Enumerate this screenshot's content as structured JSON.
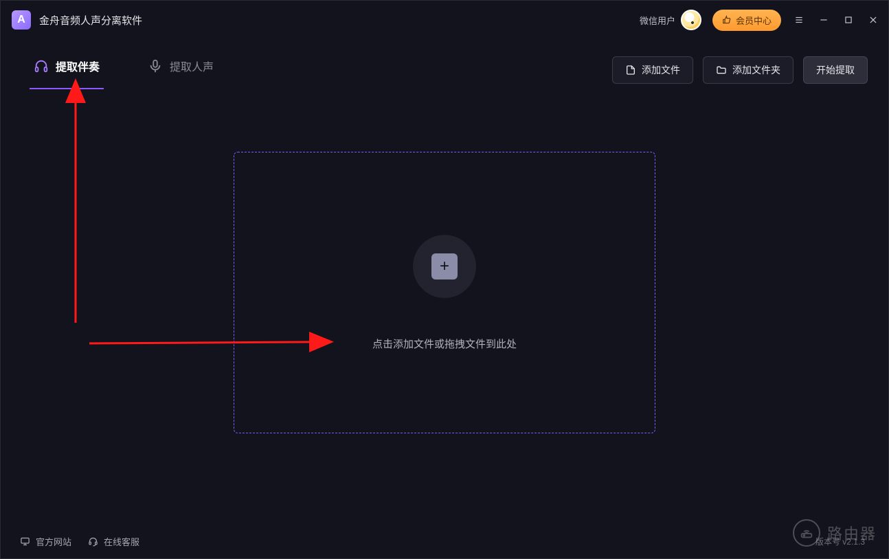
{
  "app": {
    "logo_letter": "A",
    "title": "金舟音频人声分离软件"
  },
  "titlebar": {
    "user_label": "微信用户",
    "vip_label": "会员中心"
  },
  "tabs": {
    "extract_accompaniment": "提取伴奏",
    "extract_vocals": "提取人声"
  },
  "toolbar": {
    "add_file": "添加文件",
    "add_folder": "添加文件夹",
    "start_extract": "开始提取"
  },
  "dropzone": {
    "hint": "点击添加文件或拖拽文件到此处"
  },
  "footer": {
    "official_site": "官方网站",
    "online_service": "在线客服",
    "version": "版本号 v2.1.3"
  },
  "watermark": "路由器"
}
